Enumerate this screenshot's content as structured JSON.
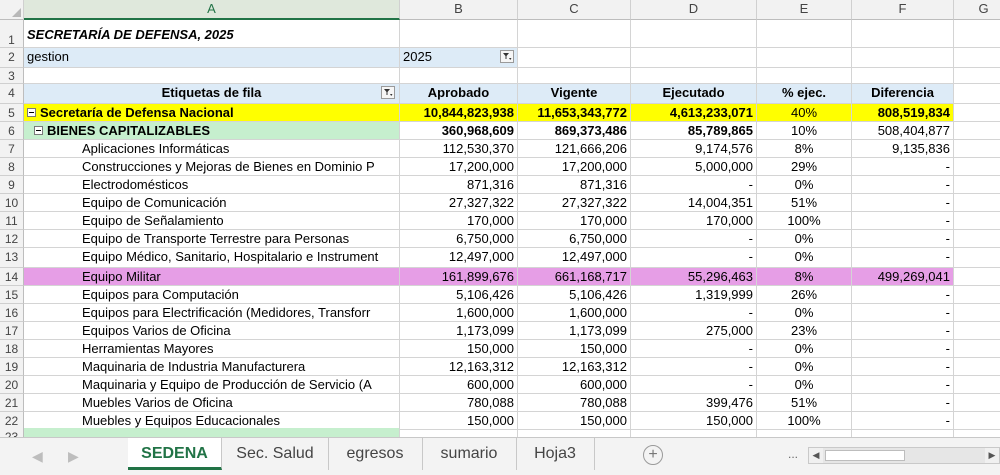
{
  "columns": [
    "A",
    "B",
    "C",
    "D",
    "E",
    "F",
    "G"
  ],
  "title_row": {
    "num": "1",
    "text": "SECRETARÍA DE DEFENSA, 2025"
  },
  "filter_row": {
    "num": "2",
    "label": "gestion",
    "value": "2025"
  },
  "empty_row": {
    "num": "3"
  },
  "header_row": {
    "num": "4",
    "labels": [
      "Etiquetas de fila",
      "Aprobado",
      "Vigente",
      "Ejecutado",
      "% ejec.",
      "Diferencia"
    ]
  },
  "data_rows": [
    {
      "num": "5",
      "level": 0,
      "style": "yellow",
      "label": "Secretaría de Defensa Nacional",
      "aprobado": "10,844,823,938",
      "vigente": "11,653,343,772",
      "ejecutado": "4,613,233,071",
      "pct": "40%",
      "dif": "808,519,834"
    },
    {
      "num": "6",
      "level": 1,
      "style": "green",
      "label": "BIENES CAPITALIZABLES",
      "aprobado": "360,968,609",
      "vigente": "869,373,486",
      "ejecutado": "85,789,865",
      "pct": "10%",
      "dif": "508,404,877"
    },
    {
      "num": "7",
      "level": 2,
      "style": "",
      "label": "Aplicaciones Informáticas",
      "aprobado": "112,530,370",
      "vigente": "121,666,206",
      "ejecutado": "9,174,576",
      "pct": "8%",
      "dif": "9,135,836"
    },
    {
      "num": "8",
      "level": 2,
      "style": "",
      "label": "Construcciones y Mejoras de Bienes en Dominio P",
      "aprobado": "17,200,000",
      "vigente": "17,200,000",
      "ejecutado": "5,000,000",
      "pct": "29%",
      "dif": "-"
    },
    {
      "num": "9",
      "level": 2,
      "style": "",
      "label": "Electrodomésticos",
      "aprobado": "871,316",
      "vigente": "871,316",
      "ejecutado": "-",
      "pct": "0%",
      "dif": "-"
    },
    {
      "num": "10",
      "level": 2,
      "style": "",
      "label": "Equipo de Comunicación",
      "aprobado": "27,327,322",
      "vigente": "27,327,322",
      "ejecutado": "14,004,351",
      "pct": "51%",
      "dif": "-"
    },
    {
      "num": "11",
      "level": 2,
      "style": "",
      "label": "Equipo de Señalamiento",
      "aprobado": "170,000",
      "vigente": "170,000",
      "ejecutado": "170,000",
      "pct": "100%",
      "dif": "-"
    },
    {
      "num": "12",
      "level": 2,
      "style": "",
      "label": "Equipo de Transporte Terrestre para Personas",
      "aprobado": "6,750,000",
      "vigente": "6,750,000",
      "ejecutado": "-",
      "pct": "0%",
      "dif": "-"
    },
    {
      "num": "13",
      "level": 2,
      "style": "",
      "label": "Equipo Médico, Sanitario, Hospitalario e Instrument",
      "aprobado": "12,497,000",
      "vigente": "12,497,000",
      "ejecutado": "-",
      "pct": "0%",
      "dif": "-"
    },
    {
      "num": "14",
      "level": 2,
      "style": "pink",
      "label": "Equipo Militar",
      "aprobado": "161,899,676",
      "vigente": "661,168,717",
      "ejecutado": "55,296,463",
      "pct": "8%",
      "dif": "499,269,041"
    },
    {
      "num": "15",
      "level": 2,
      "style": "",
      "label": "Equipos para Computación",
      "aprobado": "5,106,426",
      "vigente": "5,106,426",
      "ejecutado": "1,319,999",
      "pct": "26%",
      "dif": "-"
    },
    {
      "num": "16",
      "level": 2,
      "style": "",
      "label": "Equipos para Electrificación (Medidores, Transforr",
      "aprobado": "1,600,000",
      "vigente": "1,600,000",
      "ejecutado": "-",
      "pct": "0%",
      "dif": "-"
    },
    {
      "num": "17",
      "level": 2,
      "style": "",
      "label": "Equipos Varios de Oficina",
      "aprobado": "1,173,099",
      "vigente": "1,173,099",
      "ejecutado": "275,000",
      "pct": "23%",
      "dif": "-"
    },
    {
      "num": "18",
      "level": 2,
      "style": "",
      "label": "Herramientas Mayores",
      "aprobado": "150,000",
      "vigente": "150,000",
      "ejecutado": "-",
      "pct": "0%",
      "dif": "-"
    },
    {
      "num": "19",
      "level": 2,
      "style": "",
      "label": "Maquinaria de Industria Manufacturera",
      "aprobado": "12,163,312",
      "vigente": "12,163,312",
      "ejecutado": "-",
      "pct": "0%",
      "dif": "-"
    },
    {
      "num": "20",
      "level": 2,
      "style": "",
      "label": "Maquinaria y Equipo de Producción de Servicio  (A",
      "aprobado": "600,000",
      "vigente": "600,000",
      "ejecutado": "-",
      "pct": "0%",
      "dif": "-"
    },
    {
      "num": "21",
      "level": 2,
      "style": "",
      "label": "Muebles Varios de Oficina",
      "aprobado": "780,088",
      "vigente": "780,088",
      "ejecutado": "399,476",
      "pct": "51%",
      "dif": "-"
    },
    {
      "num": "22",
      "level": 2,
      "style": "",
      "label": "Muebles y Equipos Educacionales",
      "aprobado": "150,000",
      "vigente": "150,000",
      "ejecutado": "150,000",
      "pct": "100%",
      "dif": "-"
    }
  ],
  "partial_row": {
    "num": "23",
    "style": "green"
  },
  "tabs": [
    "SEDENA",
    "Sec. Salud",
    "egresos",
    "sumario",
    "Hoja3"
  ],
  "active_tab": "SEDENA",
  "nav": {
    "prev": "◀",
    "next": "▶",
    "add": "+",
    "ellipsis": "...",
    "scroll_left": "◀",
    "scroll_right": "▶"
  },
  "colors": {
    "yellow": "#ffff00",
    "green": "#c6efce",
    "pink": "#e69ee6",
    "blue": "#ddebf7",
    "excel_green": "#217346"
  }
}
